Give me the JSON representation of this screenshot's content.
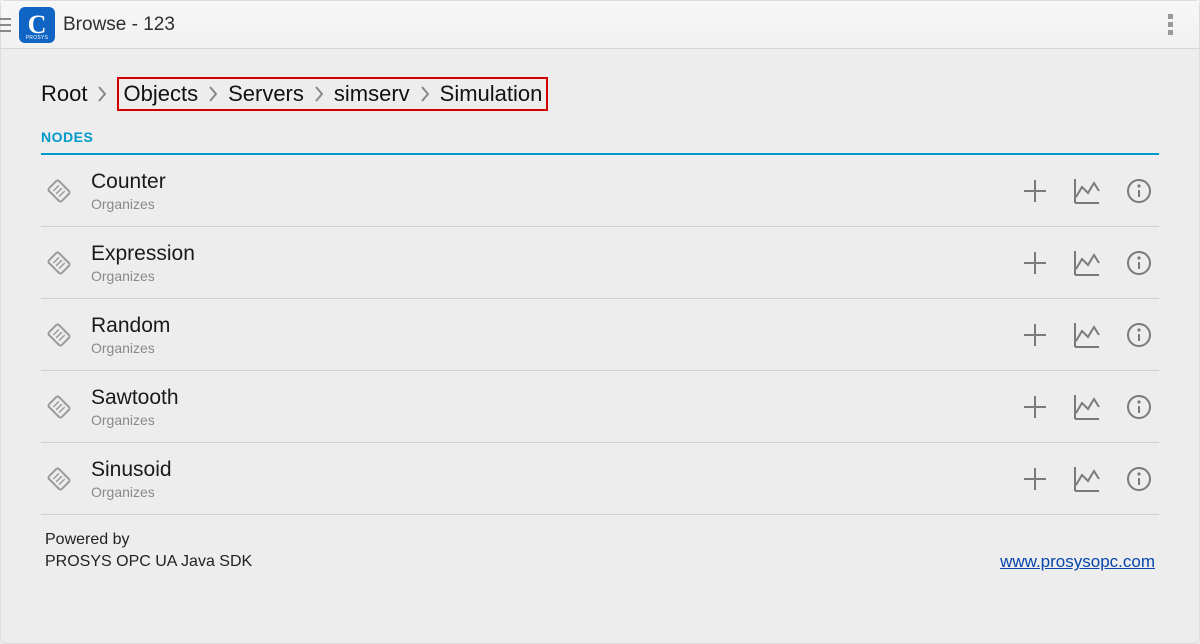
{
  "header": {
    "title": "Browse - 123"
  },
  "breadcrumb": {
    "root": "Root",
    "items": [
      "Objects",
      "Servers",
      "simserv",
      "Simulation"
    ]
  },
  "section": {
    "label": "NODES"
  },
  "nodes": [
    {
      "title": "Counter",
      "subtitle": "Organizes"
    },
    {
      "title": "Expression",
      "subtitle": "Organizes"
    },
    {
      "title": "Random",
      "subtitle": "Organizes"
    },
    {
      "title": "Sawtooth",
      "subtitle": "Organizes"
    },
    {
      "title": "Sinusoid",
      "subtitle": "Organizes"
    }
  ],
  "footer": {
    "line1": "Powered by",
    "line2": "PROSYS OPC UA Java SDK",
    "link": "www.prosysopc.com"
  }
}
